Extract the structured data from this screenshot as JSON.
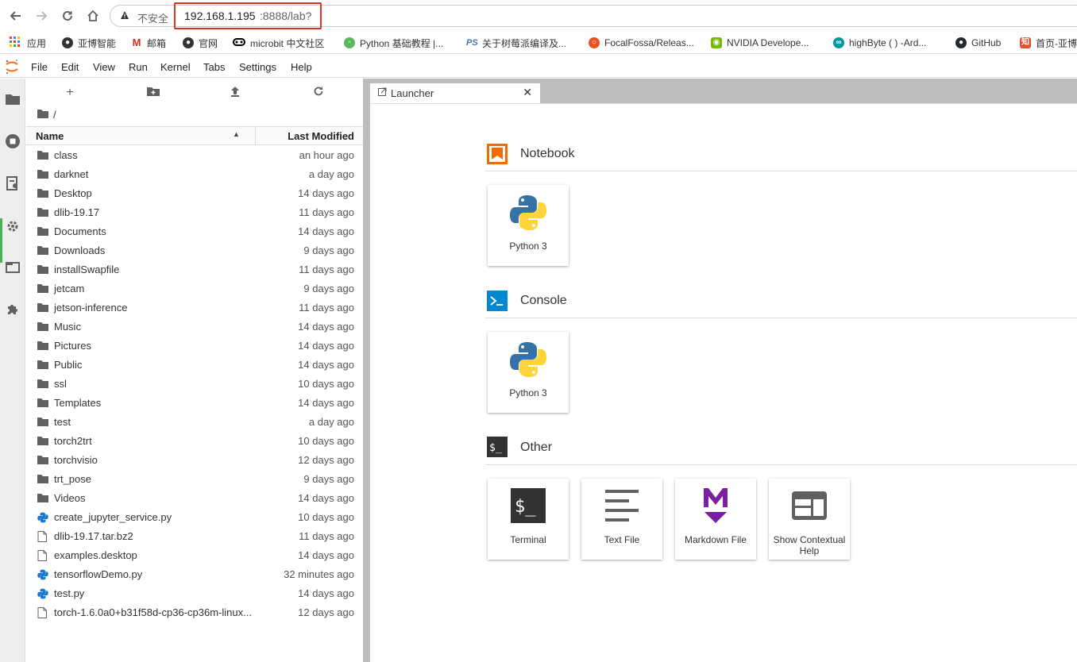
{
  "browser": {
    "insecure_label": "不安全",
    "url_host": "192.168.1.195",
    "url_rest": ":8888/lab?",
    "bookmarks": [
      {
        "label": "应用",
        "icon": "apps-grid-icon",
        "color": "#4285f4"
      },
      {
        "label": "亚博智能",
        "icon": "yahboom-icon",
        "color": "#333333"
      },
      {
        "label": "邮箱",
        "icon": "gmail-icon",
        "color": "#d93025"
      },
      {
        "label": "官网",
        "icon": "yahboom-site-icon",
        "color": "#333333"
      },
      {
        "label": "microbit 中文社区",
        "icon": "microbit-icon",
        "color": "#000000"
      },
      {
        "label": "Python 基础教程 |...",
        "icon": "runoob-icon",
        "color": "#5cb85c"
      },
      {
        "label": "关于树莓派编译及...",
        "icon": "csdn-icon",
        "color": "#3b73b9"
      },
      {
        "label": "FocalFossa/Releas...",
        "icon": "ubuntu-icon",
        "color": "#e95420"
      },
      {
        "label": "NVIDIA Develope...",
        "icon": "nvidia-icon",
        "color": "#76b900"
      },
      {
        "label": "highByte ( ) -Ard...",
        "icon": "arduino-icon",
        "color": "#00979d"
      },
      {
        "label": "GitHub",
        "icon": "github-icon",
        "color": "#24292e"
      },
      {
        "label": "首页-亚博",
        "icon": "zhihu-icon",
        "color": "#e04f2e"
      }
    ]
  },
  "menu": [
    "File",
    "Edit",
    "View",
    "Run",
    "Kernel",
    "Tabs",
    "Settings",
    "Help"
  ],
  "filebrowser": {
    "breadcrumb": "/",
    "col_name": "Name",
    "col_modified": "Last Modified",
    "items": [
      {
        "name": "class",
        "modified": "an hour ago",
        "type": "folder"
      },
      {
        "name": "darknet",
        "modified": "a day ago",
        "type": "folder"
      },
      {
        "name": "Desktop",
        "modified": "14 days ago",
        "type": "folder"
      },
      {
        "name": "dlib-19.17",
        "modified": "11 days ago",
        "type": "folder"
      },
      {
        "name": "Documents",
        "modified": "14 days ago",
        "type": "folder"
      },
      {
        "name": "Downloads",
        "modified": "9 days ago",
        "type": "folder"
      },
      {
        "name": "installSwapfile",
        "modified": "11 days ago",
        "type": "folder"
      },
      {
        "name": "jetcam",
        "modified": "9 days ago",
        "type": "folder"
      },
      {
        "name": "jetson-inference",
        "modified": "11 days ago",
        "type": "folder"
      },
      {
        "name": "Music",
        "modified": "14 days ago",
        "type": "folder"
      },
      {
        "name": "Pictures",
        "modified": "14 days ago",
        "type": "folder"
      },
      {
        "name": "Public",
        "modified": "14 days ago",
        "type": "folder"
      },
      {
        "name": "ssl",
        "modified": "10 days ago",
        "type": "folder"
      },
      {
        "name": "Templates",
        "modified": "14 days ago",
        "type": "folder"
      },
      {
        "name": "test",
        "modified": "a day ago",
        "type": "folder"
      },
      {
        "name": "torch2trt",
        "modified": "10 days ago",
        "type": "folder"
      },
      {
        "name": "torchvisio",
        "modified": "12 days ago",
        "type": "folder"
      },
      {
        "name": "trt_pose",
        "modified": "9 days ago",
        "type": "folder"
      },
      {
        "name": "Videos",
        "modified": "14 days ago",
        "type": "folder"
      },
      {
        "name": "create_jupyter_service.py",
        "modified": "10 days ago",
        "type": "python"
      },
      {
        "name": "dlib-19.17.tar.bz2",
        "modified": "11 days ago",
        "type": "file"
      },
      {
        "name": "examples.desktop",
        "modified": "14 days ago",
        "type": "file"
      },
      {
        "name": "tensorflowDemo.py",
        "modified": "32 minutes ago",
        "type": "python"
      },
      {
        "name": "test.py",
        "modified": "14 days ago",
        "type": "python"
      },
      {
        "name": "torch-1.6.0a0+b31f58d-cp36-cp36m-linux...",
        "modified": "12 days ago",
        "type": "file"
      }
    ]
  },
  "tab": {
    "label": "Launcher"
  },
  "launcher": {
    "notebook": {
      "title": "Notebook",
      "card": "Python 3"
    },
    "console": {
      "title": "Console",
      "card": "Python 3"
    },
    "other": {
      "title": "Other",
      "cards": [
        "Terminal",
        "Text File",
        "Markdown File",
        "Show Contextual Help"
      ]
    }
  },
  "colors": {
    "notebook_icon": "#ef6c00",
    "console_icon": "#0288d1",
    "other_icon": "#333333",
    "markdown": "#7b1fa2",
    "active_indicator": "#4caf50",
    "url_highlight": "#d93025"
  }
}
